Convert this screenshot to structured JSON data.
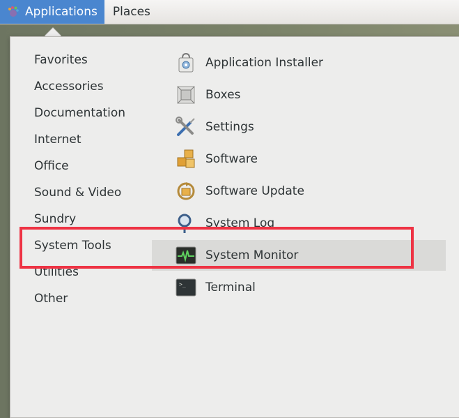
{
  "topbar": {
    "applications_label": "Applications",
    "places_label": "Places",
    "applications_icon": "gnome-foot-icon"
  },
  "categories": [
    {
      "label": "Favorites"
    },
    {
      "label": "Accessories"
    },
    {
      "label": "Documentation"
    },
    {
      "label": "Internet"
    },
    {
      "label": "Office"
    },
    {
      "label": "Sound & Video"
    },
    {
      "label": "Sundry"
    },
    {
      "label": "System Tools",
      "selected": true
    },
    {
      "label": "Utilities"
    },
    {
      "label": "Other"
    }
  ],
  "apps": [
    {
      "label": "Application Installer",
      "icon": "shopping-bag-icon"
    },
    {
      "label": "Boxes",
      "icon": "boxes-icon"
    },
    {
      "label": "Settings",
      "icon": "wrench-screwdriver-icon"
    },
    {
      "label": "Software",
      "icon": "packages-icon"
    },
    {
      "label": "Software Update",
      "icon": "software-update-icon"
    },
    {
      "label": "System Log",
      "icon": "magnifier-icon"
    },
    {
      "label": "System Monitor",
      "icon": "monitor-pulse-icon",
      "hovered": true
    },
    {
      "label": "Terminal",
      "icon": "terminal-icon"
    }
  ],
  "colors": {
    "accent": "#4a86cf",
    "highlight_box": "#ee3344",
    "hover_row": "#dadad8"
  }
}
